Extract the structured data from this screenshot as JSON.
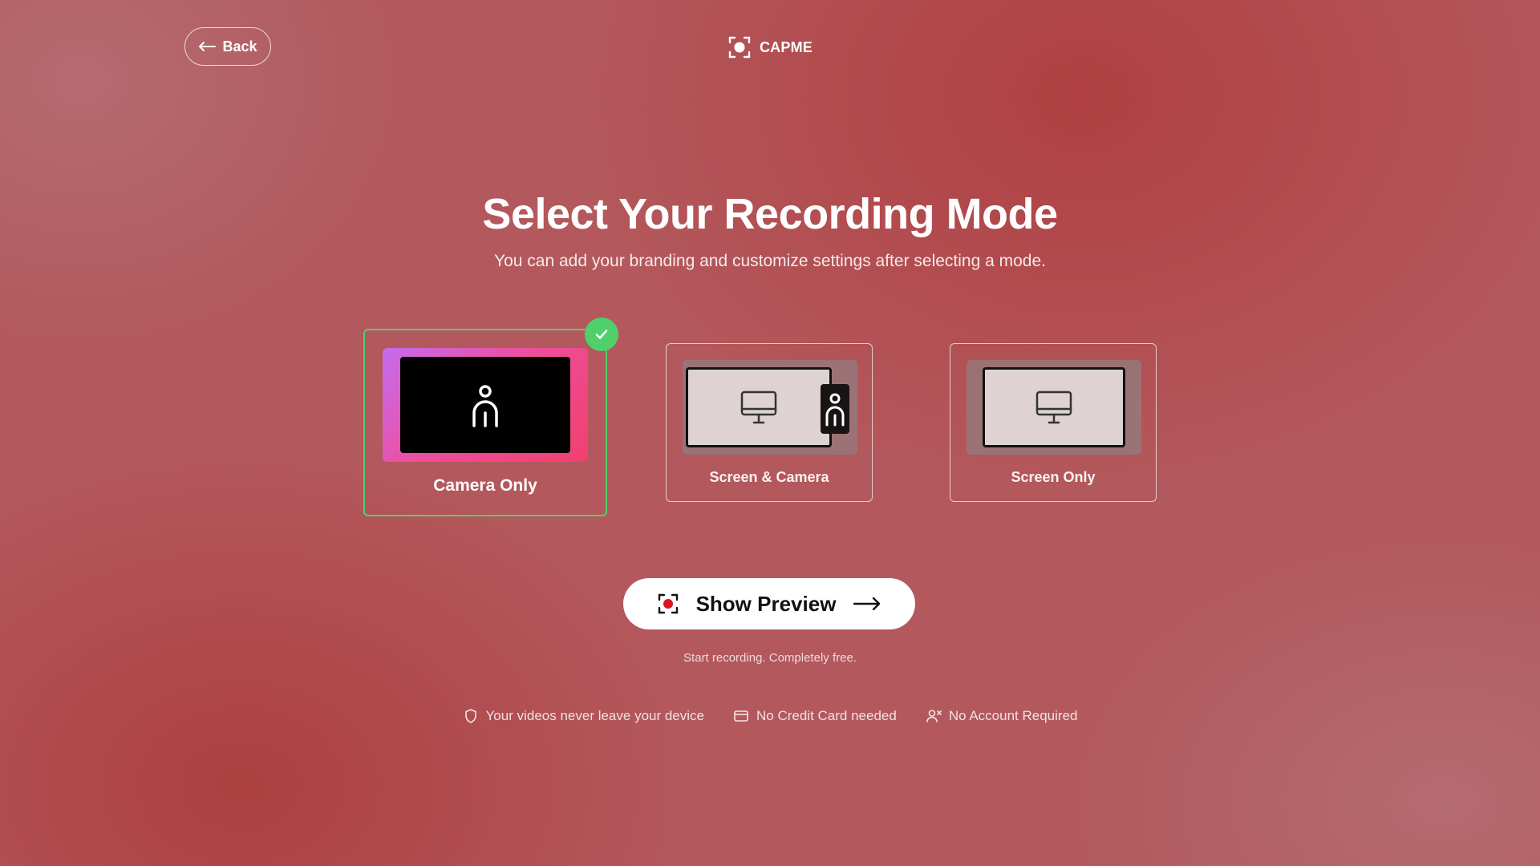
{
  "header": {
    "back_label": "Back",
    "brand_name": "CAPME"
  },
  "main": {
    "title": "Select Your Recording Mode",
    "subtitle": "You can add your branding and customize settings after selecting a mode.",
    "modes": [
      {
        "label": "Camera Only",
        "selected": true
      },
      {
        "label": "Screen & Camera",
        "selected": false
      },
      {
        "label": "Screen Only",
        "selected": false
      }
    ],
    "cta": {
      "label": "Show Preview",
      "note": "Start recording. Completely free."
    },
    "features": [
      {
        "icon": "shield-icon",
        "text": "Your videos never leave your device"
      },
      {
        "icon": "credit-card-icon",
        "text": "No Credit Card needed"
      },
      {
        "icon": "user-x-icon",
        "text": "No Account Required"
      }
    ]
  },
  "colors": {
    "background": "#b3585c",
    "selected_border": "#4fd06b",
    "record_red": "#e0141e",
    "camera_gradient_start": "#c46cf0",
    "camera_gradient_end": "#f0406d"
  }
}
